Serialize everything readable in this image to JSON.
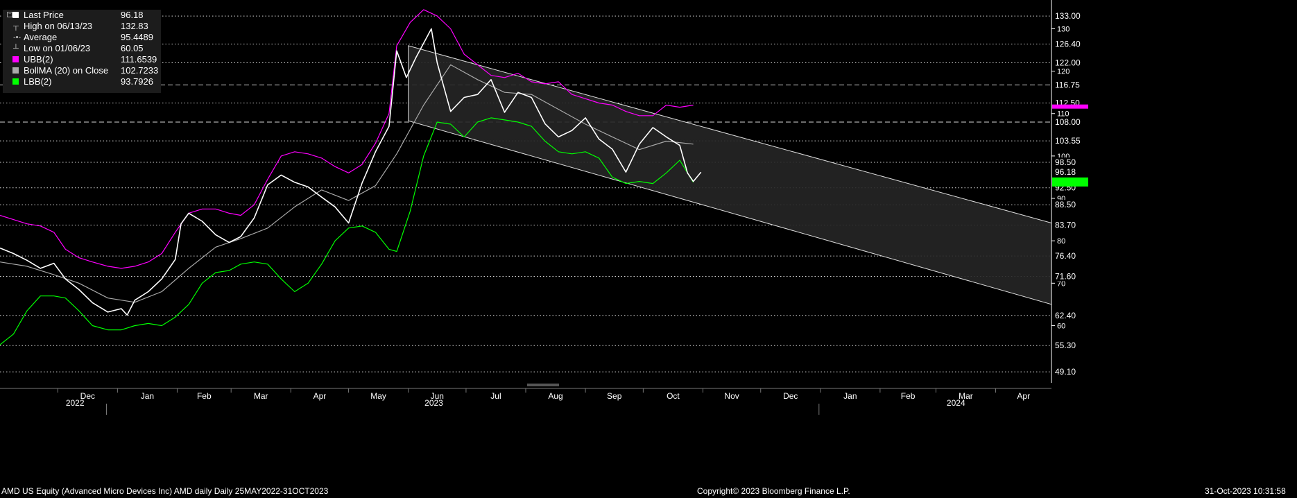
{
  "legend": {
    "items": [
      {
        "label": "Last Price",
        "value": "96.18",
        "color": "#ffffff",
        "marker": "box"
      },
      {
        "label": "High on 06/13/23",
        "value": "132.83",
        "color": "#bbbbbb",
        "marker": "high"
      },
      {
        "label": "Average",
        "value": "95.4489",
        "color": "#bbbbbb",
        "marker": "avg"
      },
      {
        "label": "Low on 01/06/23",
        "value": "60.05",
        "color": "#bbbbbb",
        "marker": "low"
      },
      {
        "label": "UBB(2)",
        "value": "111.6539",
        "color": "#ff00ff",
        "marker": "box"
      },
      {
        "label": "BollMA (20)  on Close",
        "value": "102.7233",
        "color": "#aaaaaa",
        "marker": "box"
      },
      {
        "label": "LBB(2)",
        "value": "93.7926",
        "color": "#00ff00",
        "marker": "box"
      }
    ]
  },
  "footer": {
    "left": "AMD US Equity (Advanced Micro Devices Inc) AMD daily  Daily 25MAY2022-31OCT2023",
    "center": "Copyright© 2023 Bloomberg Finance L.P.",
    "right": "31-Oct-2023 10:31:58"
  },
  "chart_data": {
    "type": "candlestick",
    "ylim": [
      46.5,
      135.8
    ],
    "x_range": [
      "2022-11-01",
      "2024-04-30"
    ],
    "x_month_labels": [
      "Dec",
      "Jan",
      "Feb",
      "Mar",
      "Apr",
      "May",
      "Jun",
      "Jul",
      "Aug",
      "Sep",
      "Oct",
      "Nov",
      "Dec",
      "Jan",
      "Feb",
      "Mar",
      "Apr"
    ],
    "x_year_labels": [
      {
        "text": "2022",
        "month_index": 0
      },
      {
        "text": "2023",
        "month_index": 6
      },
      {
        "text": "2024",
        "month_index": 14
      }
    ],
    "y_tick_labels": [
      {
        "value": 130,
        "text": "130"
      },
      {
        "value": 120,
        "text": "120"
      },
      {
        "value": 110,
        "text": "110"
      },
      {
        "value": 100,
        "text": "100"
      },
      {
        "value": 90,
        "text": "90"
      },
      {
        "value": 80,
        "text": "80"
      },
      {
        "value": 70,
        "text": "70"
      },
      {
        "value": 60,
        "text": "60"
      }
    ],
    "price_levels": [
      {
        "value": 133.0,
        "text": "133.00",
        "style": "dotted"
      },
      {
        "value": 126.4,
        "text": "126.40",
        "style": "dotted"
      },
      {
        "value": 122.0,
        "text": "122.00",
        "style": "dotted"
      },
      {
        "value": 116.75,
        "text": "116.75",
        "style": "dashed"
      },
      {
        "value": 112.5,
        "text": "112.50",
        "style": "dotted"
      },
      {
        "value": 108.0,
        "text": "108.00",
        "style": "dashed"
      },
      {
        "value": 103.55,
        "text": "103.55",
        "style": "dotted"
      },
      {
        "value": 98.5,
        "text": "98.50",
        "style": "dotted"
      },
      {
        "value": 92.5,
        "text": "92.50",
        "style": "dotted"
      },
      {
        "value": 88.5,
        "text": "88.50",
        "style": "dotted"
      },
      {
        "value": 83.7,
        "text": "83.70",
        "style": "dotted"
      },
      {
        "value": 76.4,
        "text": "76.40",
        "style": "dotted"
      },
      {
        "value": 71.6,
        "text": "71.60",
        "style": "dotted"
      },
      {
        "value": 62.4,
        "text": "62.40",
        "style": "dotted"
      },
      {
        "value": 55.3,
        "text": "55.30",
        "style": "dotted"
      },
      {
        "value": 49.1,
        "text": "49.10",
        "style": "dotted"
      }
    ],
    "last_price": {
      "value": 96.18,
      "text": "96.18",
      "color": "#ffffff"
    },
    "lbb_tag": {
      "value": 93.79,
      "color": "#00ff00"
    },
    "ubb_tag": {
      "value": 111.65,
      "color": "#ff00ff"
    },
    "channel": {
      "upper": [
        [
          "2023-06-01",
          126.0
        ],
        [
          "2024-04-30",
          84.2
        ]
      ],
      "lower": [
        [
          "2023-06-01",
          108.3
        ],
        [
          "2024-04-30",
          65.0
        ]
      ],
      "fill": "#262626",
      "stroke": "#dddddd"
    },
    "series": [
      {
        "name": "Last Price",
        "color": "#ffffff",
        "points": [
          [
            "2022-11-01",
            78.3
          ],
          [
            "2022-11-08",
            77.0
          ],
          [
            "2022-11-15",
            75.4
          ],
          [
            "2022-11-22",
            73.5
          ],
          [
            "2022-11-29",
            74.7
          ],
          [
            "2022-12-05",
            71.0
          ],
          [
            "2022-12-12",
            68.5
          ],
          [
            "2022-12-19",
            65.4
          ],
          [
            "2022-12-27",
            63.2
          ],
          [
            "2023-01-03",
            64.0
          ],
          [
            "2023-01-06",
            62.5
          ],
          [
            "2023-01-10",
            66.0
          ],
          [
            "2023-01-17",
            68.0
          ],
          [
            "2023-01-24",
            71.0
          ],
          [
            "2023-01-31",
            75.6
          ],
          [
            "2023-02-03",
            84.0
          ],
          [
            "2023-02-07",
            86.5
          ],
          [
            "2023-02-14",
            84.6
          ],
          [
            "2023-02-21",
            81.4
          ],
          [
            "2023-02-28",
            79.6
          ],
          [
            "2023-03-06",
            81.0
          ],
          [
            "2023-03-13",
            85.4
          ],
          [
            "2023-03-20",
            93.2
          ],
          [
            "2023-03-27",
            95.5
          ],
          [
            "2023-04-03",
            93.8
          ],
          [
            "2023-04-10",
            92.7
          ],
          [
            "2023-04-17",
            90.3
          ],
          [
            "2023-04-24",
            88.0
          ],
          [
            "2023-05-01",
            84.2
          ],
          [
            "2023-05-08",
            93.6
          ],
          [
            "2023-05-15",
            101.0
          ],
          [
            "2023-05-22",
            107.0
          ],
          [
            "2023-05-26",
            124.8
          ],
          [
            "2023-05-31",
            118.5
          ],
          [
            "2023-06-05",
            123.2
          ],
          [
            "2023-06-13",
            130.0
          ],
          [
            "2023-06-16",
            122.0
          ],
          [
            "2023-06-23",
            110.5
          ],
          [
            "2023-06-30",
            113.8
          ],
          [
            "2023-07-07",
            114.5
          ],
          [
            "2023-07-14",
            118.0
          ],
          [
            "2023-07-21",
            110.3
          ],
          [
            "2023-07-28",
            115.0
          ],
          [
            "2023-08-04",
            113.8
          ],
          [
            "2023-08-11",
            107.6
          ],
          [
            "2023-08-18",
            104.5
          ],
          [
            "2023-08-25",
            106.0
          ],
          [
            "2023-09-01",
            109.0
          ],
          [
            "2023-09-08",
            104.0
          ],
          [
            "2023-09-15",
            101.6
          ],
          [
            "2023-09-22",
            96.2
          ],
          [
            "2023-09-29",
            102.8
          ],
          [
            "2023-10-06",
            106.7
          ],
          [
            "2023-10-13",
            104.5
          ],
          [
            "2023-10-20",
            102.5
          ],
          [
            "2023-10-24",
            96.0
          ],
          [
            "2023-10-27",
            94.0
          ],
          [
            "2023-10-31",
            96.18
          ]
        ]
      },
      {
        "name": "UBB(2)",
        "color": "#ff00ff",
        "points": [
          [
            "2022-11-01",
            86.0
          ],
          [
            "2022-11-08",
            85.0
          ],
          [
            "2022-11-15",
            84.0
          ],
          [
            "2022-11-22",
            83.5
          ],
          [
            "2022-11-29",
            82.0
          ],
          [
            "2022-12-05",
            78.0
          ],
          [
            "2022-12-12",
            76.0
          ],
          [
            "2022-12-19",
            75.0
          ],
          [
            "2022-12-27",
            74.0
          ],
          [
            "2023-01-03",
            73.5
          ],
          [
            "2023-01-10",
            74.0
          ],
          [
            "2023-01-17",
            75.0
          ],
          [
            "2023-01-24",
            77.0
          ],
          [
            "2023-01-31",
            82.0
          ],
          [
            "2023-02-07",
            86.5
          ],
          [
            "2023-02-14",
            87.5
          ],
          [
            "2023-02-21",
            87.5
          ],
          [
            "2023-02-28",
            86.5
          ],
          [
            "2023-03-06",
            86.0
          ],
          [
            "2023-03-13",
            88.5
          ],
          [
            "2023-03-20",
            94.5
          ],
          [
            "2023-03-27",
            100.0
          ],
          [
            "2023-04-03",
            101.0
          ],
          [
            "2023-04-10",
            100.5
          ],
          [
            "2023-04-17",
            99.5
          ],
          [
            "2023-04-24",
            97.5
          ],
          [
            "2023-05-01",
            96.0
          ],
          [
            "2023-05-08",
            98.0
          ],
          [
            "2023-05-15",
            103.0
          ],
          [
            "2023-05-22",
            110.0
          ],
          [
            "2023-05-26",
            126.0
          ],
          [
            "2023-06-02",
            131.5
          ],
          [
            "2023-06-09",
            134.5
          ],
          [
            "2023-06-16",
            133.0
          ],
          [
            "2023-06-23",
            130.0
          ],
          [
            "2023-06-30",
            124.0
          ],
          [
            "2023-07-07",
            121.5
          ],
          [
            "2023-07-14",
            119.0
          ],
          [
            "2023-07-21",
            118.5
          ],
          [
            "2023-07-28",
            119.5
          ],
          [
            "2023-08-04",
            117.5
          ],
          [
            "2023-08-11",
            117.0
          ],
          [
            "2023-08-18",
            117.5
          ],
          [
            "2023-08-25",
            114.5
          ],
          [
            "2023-09-01",
            113.5
          ],
          [
            "2023-09-08",
            112.5
          ],
          [
            "2023-09-15",
            112.0
          ],
          [
            "2023-09-22",
            110.5
          ],
          [
            "2023-09-29",
            109.5
          ],
          [
            "2023-10-06",
            109.5
          ],
          [
            "2023-10-13",
            112.0
          ],
          [
            "2023-10-20",
            111.5
          ],
          [
            "2023-10-27",
            112.0
          ]
        ]
      },
      {
        "name": "BollMA (20)  on Close",
        "color": "#aaaaaa",
        "points": [
          [
            "2022-11-01",
            75.0
          ],
          [
            "2022-11-15",
            74.0
          ],
          [
            "2022-11-29",
            72.0
          ],
          [
            "2022-12-12",
            70.0
          ],
          [
            "2022-12-27",
            66.5
          ],
          [
            "2023-01-10",
            65.5
          ],
          [
            "2023-01-24",
            68.0
          ],
          [
            "2023-02-07",
            73.5
          ],
          [
            "2023-02-21",
            78.5
          ],
          [
            "2023-03-06",
            80.5
          ],
          [
            "2023-03-20",
            83.0
          ],
          [
            "2023-04-03",
            88.0
          ],
          [
            "2023-04-17",
            92.0
          ],
          [
            "2023-05-01",
            89.5
          ],
          [
            "2023-05-15",
            93.0
          ],
          [
            "2023-05-26",
            100.5
          ],
          [
            "2023-06-09",
            112.0
          ],
          [
            "2023-06-23",
            121.5
          ],
          [
            "2023-07-07",
            118.0
          ],
          [
            "2023-07-21",
            115.0
          ],
          [
            "2023-08-04",
            114.5
          ],
          [
            "2023-08-18",
            111.0
          ],
          [
            "2023-09-01",
            107.5
          ],
          [
            "2023-09-15",
            104.5
          ],
          [
            "2023-09-29",
            101.5
          ],
          [
            "2023-10-13",
            103.5
          ],
          [
            "2023-10-27",
            102.8
          ]
        ]
      },
      {
        "name": "LBB(2)",
        "color": "#00ff00",
        "points": [
          [
            "2022-11-01",
            55.5
          ],
          [
            "2022-11-08",
            58.0
          ],
          [
            "2022-11-15",
            63.5
          ],
          [
            "2022-11-22",
            67.0
          ],
          [
            "2022-11-29",
            67.0
          ],
          [
            "2022-12-05",
            66.5
          ],
          [
            "2022-12-12",
            63.5
          ],
          [
            "2022-12-19",
            60.0
          ],
          [
            "2022-12-27",
            59.0
          ],
          [
            "2023-01-03",
            59.0
          ],
          [
            "2023-01-10",
            60.0
          ],
          [
            "2023-01-17",
            60.5
          ],
          [
            "2023-01-24",
            60.0
          ],
          [
            "2023-01-31",
            62.0
          ],
          [
            "2023-02-07",
            65.0
          ],
          [
            "2023-02-14",
            70.0
          ],
          [
            "2023-02-21",
            72.5
          ],
          [
            "2023-02-28",
            73.0
          ],
          [
            "2023-03-06",
            74.5
          ],
          [
            "2023-03-13",
            75.0
          ],
          [
            "2023-03-20",
            74.5
          ],
          [
            "2023-03-27",
            71.0
          ],
          [
            "2023-04-03",
            68.0
          ],
          [
            "2023-04-10",
            70.0
          ],
          [
            "2023-04-17",
            74.5
          ],
          [
            "2023-04-24",
            80.0
          ],
          [
            "2023-05-01",
            83.0
          ],
          [
            "2023-05-08",
            83.5
          ],
          [
            "2023-05-15",
            82.0
          ],
          [
            "2023-05-22",
            78.0
          ],
          [
            "2023-05-26",
            77.5
          ],
          [
            "2023-06-02",
            87.0
          ],
          [
            "2023-06-09",
            100.0
          ],
          [
            "2023-06-16",
            108.0
          ],
          [
            "2023-06-23",
            107.5
          ],
          [
            "2023-06-30",
            104.5
          ],
          [
            "2023-07-07",
            108.0
          ],
          [
            "2023-07-14",
            109.0
          ],
          [
            "2023-07-21",
            108.5
          ],
          [
            "2023-07-28",
            108.0
          ],
          [
            "2023-08-04",
            107.0
          ],
          [
            "2023-08-11",
            103.5
          ],
          [
            "2023-08-18",
            101.0
          ],
          [
            "2023-08-25",
            100.5
          ],
          [
            "2023-09-01",
            101.0
          ],
          [
            "2023-09-08",
            99.5
          ],
          [
            "2023-09-15",
            95.0
          ],
          [
            "2023-09-22",
            93.5
          ],
          [
            "2023-09-29",
            94.0
          ],
          [
            "2023-10-06",
            93.5
          ],
          [
            "2023-10-13",
            96.0
          ],
          [
            "2023-10-20",
            99.0
          ],
          [
            "2023-10-24",
            96.0
          ],
          [
            "2023-10-27",
            93.8
          ]
        ]
      }
    ]
  }
}
